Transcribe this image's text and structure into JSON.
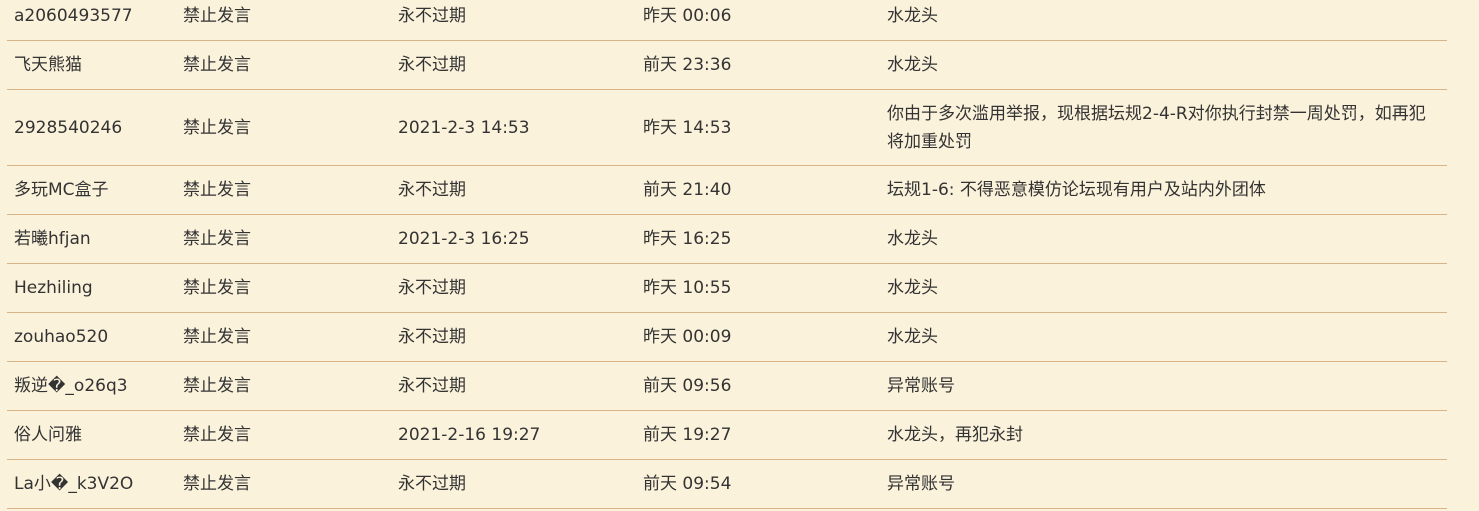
{
  "colors": {
    "background": "#fbf2db",
    "divider": "#d8b589",
    "text": "#333333"
  },
  "rows": [
    {
      "user": "a2060493577",
      "operation": "禁止发言",
      "expires": "永不过期",
      "time": "昨天 00:06",
      "reason": "水龙头"
    },
    {
      "user": "飞天熊猫",
      "operation": "禁止发言",
      "expires": "永不过期",
      "time": "前天 23:36",
      "reason": "水龙头"
    },
    {
      "user": "2928540246",
      "operation": "禁止发言",
      "expires": "2021-2-3 14:53",
      "time": "昨天 14:53",
      "reason": "你由于多次滥用举报，现根据坛规2-4-R对你执行封禁一周处罚，如再犯将加重处罚"
    },
    {
      "user": "多玩MC盒子",
      "operation": "禁止发言",
      "expires": "永不过期",
      "time": "前天 21:40",
      "reason": "坛规1-6: 不得恶意模仿论坛现有用户及站内外团体"
    },
    {
      "user": "若曦hfjan",
      "operation": "禁止发言",
      "expires": "2021-2-3 16:25",
      "time": "昨天 16:25",
      "reason": "水龙头"
    },
    {
      "user": "Hezhiling",
      "operation": "禁止发言",
      "expires": "永不过期",
      "time": "昨天 10:55",
      "reason": "水龙头"
    },
    {
      "user": "zouhao520",
      "operation": "禁止发言",
      "expires": "永不过期",
      "time": "昨天 00:09",
      "reason": "水龙头"
    },
    {
      "user": "叛逆�_o26q3",
      "operation": "禁止发言",
      "expires": "永不过期",
      "time": "前天 09:56",
      "reason": "异常账号"
    },
    {
      "user": "俗人问雅",
      "operation": "禁止发言",
      "expires": "2021-2-16 19:27",
      "time": "前天 19:27",
      "reason": "水龙头，再犯永封"
    },
    {
      "user": "La小�_k3V2O",
      "operation": "禁止发言",
      "expires": "永不过期",
      "time": "前天 09:54",
      "reason": "异常账号"
    }
  ]
}
